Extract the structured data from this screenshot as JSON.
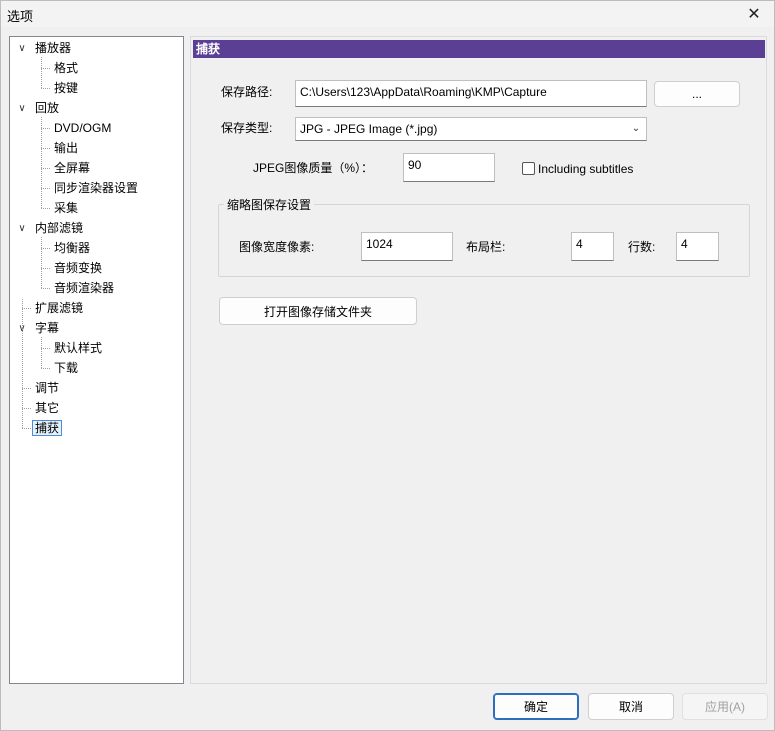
{
  "window": {
    "title": "选项",
    "close_symbol": "✕"
  },
  "tree": {
    "items": [
      {
        "label": "播放器",
        "level": 0,
        "expanded": true
      },
      {
        "label": "格式",
        "level": 1
      },
      {
        "label": "按键",
        "level": 1
      },
      {
        "label": "回放",
        "level": 0,
        "expanded": true
      },
      {
        "label": "DVD/OGM",
        "level": 1
      },
      {
        "label": "输出",
        "level": 1
      },
      {
        "label": "全屏幕",
        "level": 1
      },
      {
        "label": "同步渲染器设置",
        "level": 1
      },
      {
        "label": "采集",
        "level": 1
      },
      {
        "label": "内部滤镜",
        "level": 0,
        "expanded": true
      },
      {
        "label": "均衡器",
        "level": 1
      },
      {
        "label": "音频变换",
        "level": 1
      },
      {
        "label": "音频渲染器",
        "level": 1
      },
      {
        "label": "扩展滤镜",
        "level": 0
      },
      {
        "label": "字幕",
        "level": 0,
        "expanded": true
      },
      {
        "label": "默认样式",
        "level": 1
      },
      {
        "label": "下载",
        "level": 1
      },
      {
        "label": "调节",
        "level": 0
      },
      {
        "label": "其它",
        "level": 0
      },
      {
        "label": "捕获",
        "level": 0,
        "selected": true
      }
    ]
  },
  "capture": {
    "header": "捕获",
    "save_path_label": "保存路径:",
    "save_path_value": "C:\\Users\\123\\AppData\\Roaming\\KMP\\Capture",
    "browse_label": "...",
    "save_type_label": "保存类型:",
    "save_type_value": "JPG - JPEG Image (*.jpg)",
    "jpeg_quality_label": "JPEG图像质量（%）：",
    "jpeg_quality_value": "90",
    "include_subtitles_label": "Including subtitles",
    "include_subtitles_checked": false,
    "thumb_group_title": "缩略图保存设置",
    "image_width_label": "图像宽度像素:",
    "image_width_value": "1024",
    "columns_label": "布局栏:",
    "columns_value": "4",
    "rows_label": "行数:",
    "rows_value": "4",
    "open_folder_label": "打开图像存储文件夹"
  },
  "footer": {
    "ok_label": "确定",
    "cancel_label": "取消",
    "apply_label": "应用(A)"
  }
}
